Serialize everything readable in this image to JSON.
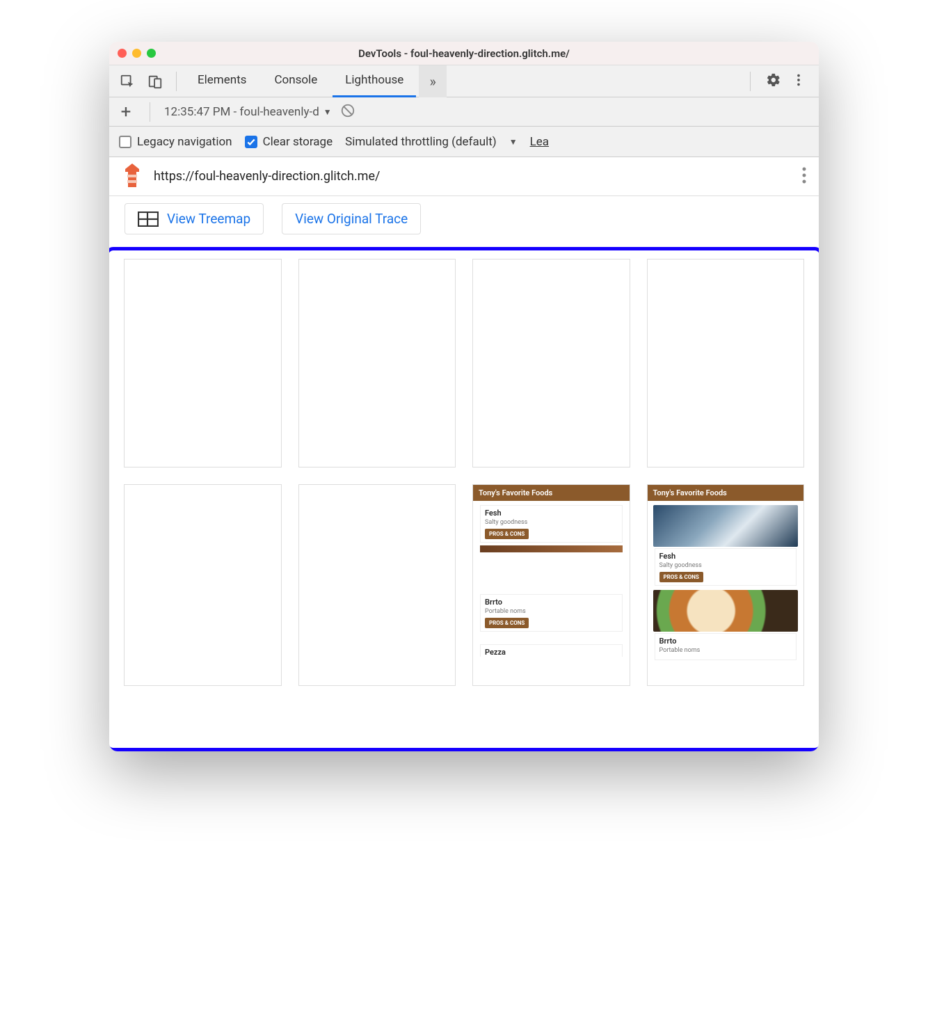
{
  "window": {
    "title": "DevTools - foul-heavenly-direction.glitch.me/"
  },
  "tabs": {
    "elements": "Elements",
    "console": "Console",
    "lighthouse": "Lighthouse",
    "overflow_glyph": "»"
  },
  "session": {
    "plus_glyph": "+",
    "label": "12:35:47 PM - foul-heavenly-d",
    "caret_glyph": "▼"
  },
  "options": {
    "legacy_nav": "Legacy navigation",
    "clear_storage": "Clear storage",
    "throttling": "Simulated throttling (default)",
    "caret_glyph": "▼",
    "learn_truncated": "Lea"
  },
  "url_row": {
    "url": "https://foul-heavenly-direction.glitch.me/"
  },
  "buttons": {
    "treemap": "View Treemap",
    "trace": "View Original Trace"
  },
  "filmstrip": {
    "frame7": {
      "header": "Tony's Favorite Foods",
      "items": [
        {
          "title": "Fesh",
          "sub": "Salty goodness",
          "btn": "PROS & CONS"
        },
        {
          "title": "Brrto",
          "sub": "Portable noms",
          "btn": "PROS & CONS"
        },
        {
          "title": "Pezza",
          "sub": "",
          "btn": ""
        }
      ]
    },
    "frame8": {
      "header": "Tony's Favorite Foods",
      "items": [
        {
          "title": "Fesh",
          "sub": "Salty goodness",
          "btn": "PROS & CONS"
        },
        {
          "title": "Brrto",
          "sub": "Portable noms",
          "btn": ""
        }
      ]
    }
  }
}
